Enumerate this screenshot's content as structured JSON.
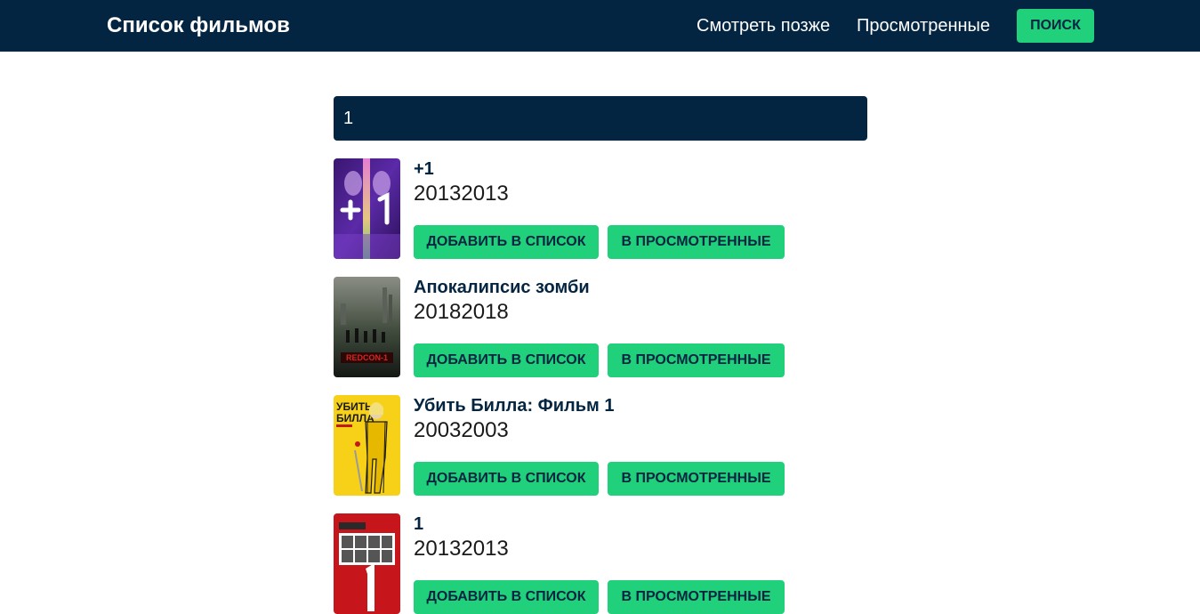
{
  "header": {
    "brand": "Список фильмов",
    "nav_watch_later": "Смотреть позже",
    "nav_watched": "Просмотренные",
    "search_button": "ПОИСК"
  },
  "search": {
    "value": "1"
  },
  "movies": [
    {
      "title": "+1",
      "year": "20132013",
      "add_label": "ДОБАВИТЬ В СПИСОК",
      "watched_label": "В ПРОСМОТРЕННЫЕ"
    },
    {
      "title": "Апокалипсис зомби",
      "year": "20182018",
      "add_label": "ДОБАВИТЬ В СПИСОК",
      "watched_label": "В ПРОСМОТРЕННЫЕ",
      "poster_text": "REDCON-1"
    },
    {
      "title": "Убить Билла: Фильм 1",
      "year": "20032003",
      "add_label": "ДОБАВИТЬ В СПИСОК",
      "watched_label": "В ПРОСМОТРЕННЫЕ",
      "poster_text": "УБИТЬ БИЛЛА"
    },
    {
      "title": "1",
      "year": "20132013",
      "add_label": "ДОБАВИТЬ В СПИСОК",
      "watched_label": "В ПРОСМОТРЕННЫЕ"
    }
  ],
  "colors": {
    "navbar": "#032541",
    "accent": "#21d07a"
  }
}
